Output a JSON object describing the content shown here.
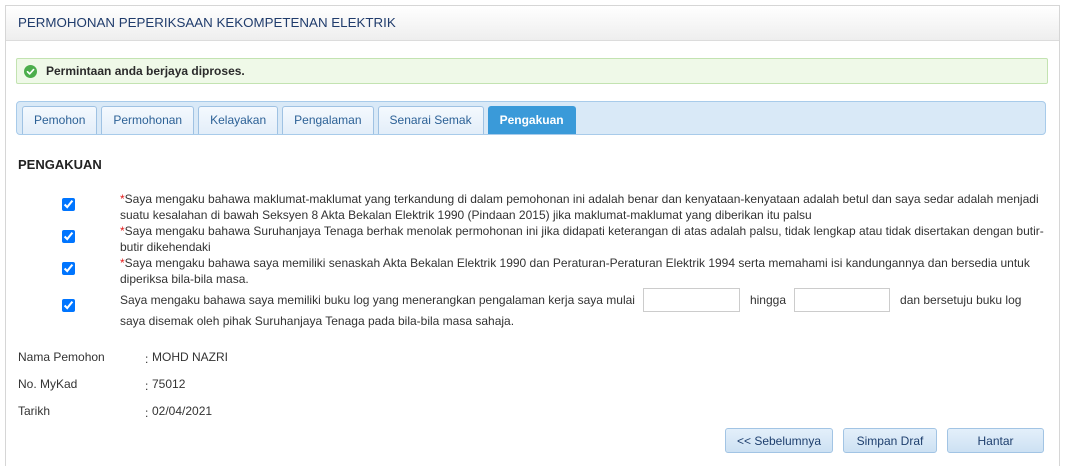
{
  "header": {
    "title": "PERMOHONAN PEPERIKSAAN KEKOMPETENAN ELEKTRIK"
  },
  "alert": {
    "icon": "check-circle-icon",
    "message": "Permintaan anda berjaya diproses."
  },
  "tabs": [
    {
      "label": "Pemohon",
      "active": false
    },
    {
      "label": "Permohonan",
      "active": false
    },
    {
      "label": "Kelayakan",
      "active": false
    },
    {
      "label": "Pengalaman",
      "active": false
    },
    {
      "label": "Senarai Semak",
      "active": false
    },
    {
      "label": "Pengakuan",
      "active": true
    }
  ],
  "section": {
    "title": "PENGAKUAN"
  },
  "declarations": [
    {
      "checked": true,
      "required_mark": "*",
      "text": "Saya mengaku bahawa maklumat-maklumat yang terkandung di dalam pemohonan ini adalah benar dan kenyataan-kenyataan adalah betul dan saya sedar adalah menjadi suatu kesalahan di bawah Seksyen 8 Akta Bekalan Elektrik 1990 (Pindaan 2015) jika maklumat-maklumat yang diberikan itu palsu"
    },
    {
      "checked": true,
      "required_mark": "*",
      "text": "Saya mengaku bahawa Suruhanjaya Tenaga berhak menolak permohonan ini jika didapati keterangan di atas adalah palsu, tidak lengkap atau tidak disertakan dengan butir-butir dikehendaki"
    },
    {
      "checked": true,
      "required_mark": "*",
      "text": "Saya mengaku bahawa saya memiliki senaskah Akta Bekalan Elektrik 1990 dan Peraturan-Peraturan Elektrik 1994 serta memahami isi kandungannya dan bersedia untuk diperiksa bila-bila masa."
    }
  ],
  "logbook_declaration": {
    "checked": true,
    "text_before": "Saya mengaku bahawa saya memiliki buku log yang menerangkan pengalaman kerja saya mulai",
    "text_between": "hingga",
    "text_after": "dan bersetuju buku log",
    "text_continued": "saya disemak oleh pihak Suruhanjaya Tenaga pada bila-bila masa sahaja."
  },
  "applicant": {
    "separator": ":",
    "fields": [
      {
        "label": "Nama Pemohon",
        "value": "MOHD NAZRI"
      },
      {
        "label": "No. MyKad",
        "value": "75012"
      },
      {
        "label": "Tarikh",
        "value": "02/04/2021"
      }
    ]
  },
  "actions": {
    "previous_label": "<< Sebelumnya",
    "save_draft_label": "Simpan Draf",
    "submit_label": "Hantar"
  },
  "colors": {
    "header_text": "#203c6c",
    "active_tab": "#3a9ad9",
    "success": "#4cae4c",
    "required": "#e31b1b"
  }
}
